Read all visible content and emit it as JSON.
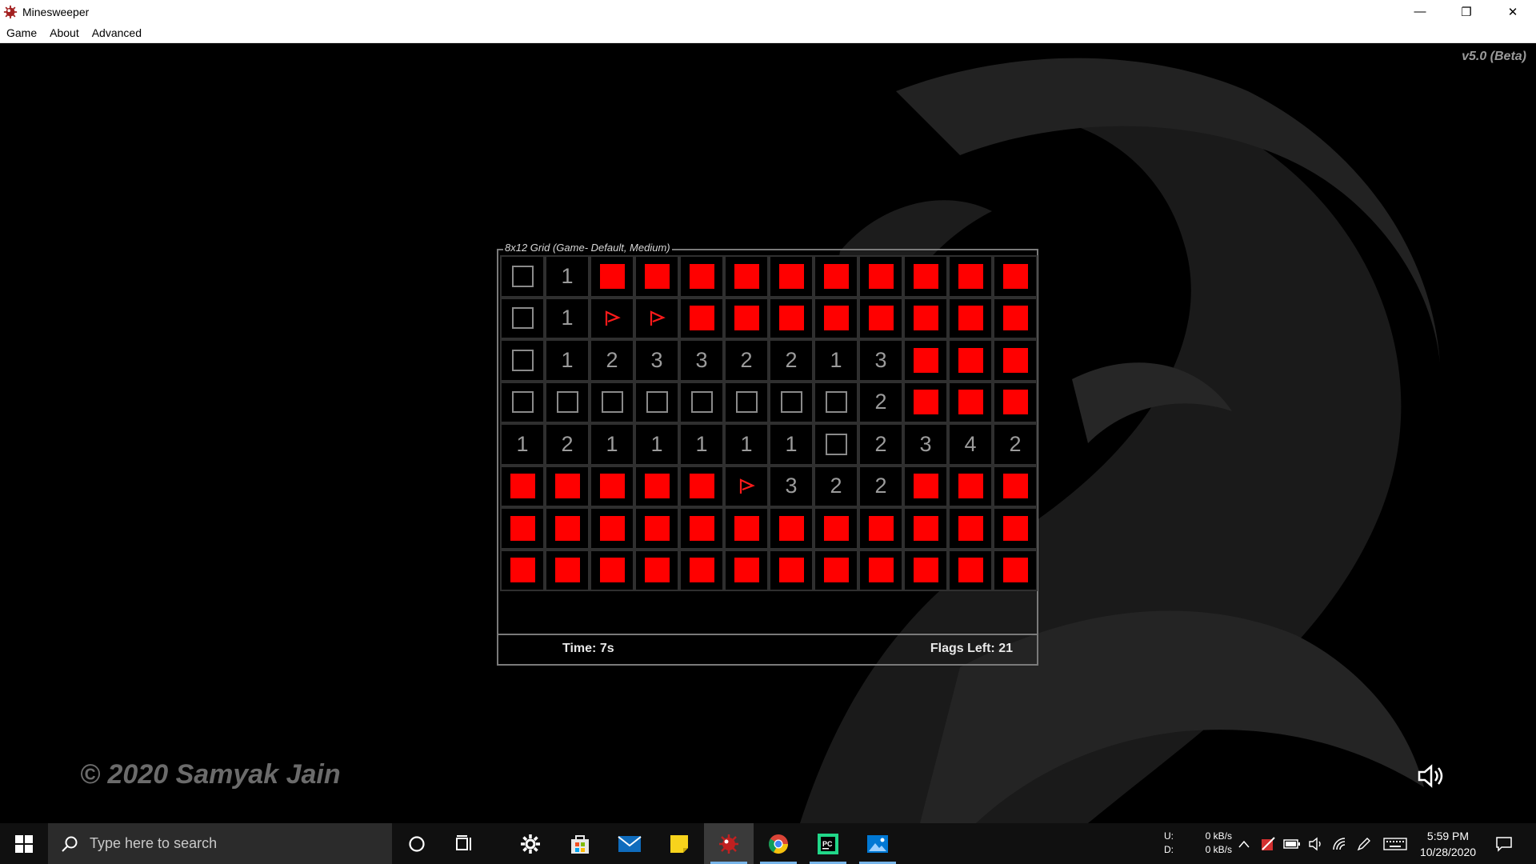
{
  "window": {
    "title": "Minesweeper",
    "controls": {
      "minimize": "—",
      "restore": "❐",
      "close": "✕"
    }
  },
  "menu": [
    "Game",
    "About",
    "Advanced"
  ],
  "version": "v5.0 (Beta)",
  "copyright": "© 2020 Samyak Jain",
  "panel": {
    "legend": "8x12 Grid (Game- Default, Medium)",
    "time": "Time: 7s",
    "flags": "Flags Left: 21"
  },
  "grid": [
    [
      "E",
      "1",
      "R",
      "R",
      "R",
      "R",
      "R",
      "R",
      "R",
      "R",
      "R",
      "R"
    ],
    [
      "E",
      "1",
      "F",
      "F",
      "R",
      "R",
      "R",
      "R",
      "R",
      "R",
      "R",
      "R"
    ],
    [
      "E",
      "1",
      "2",
      "3",
      "3",
      "2",
      "2",
      "1",
      "3",
      "R",
      "R",
      "R"
    ],
    [
      "E",
      "E",
      "E",
      "E",
      "E",
      "E",
      "E",
      "E",
      "2",
      "R",
      "R",
      "R"
    ],
    [
      "1",
      "2",
      "1",
      "1",
      "1",
      "1",
      "1",
      "E",
      "2",
      "3",
      "4",
      "2"
    ],
    [
      "R",
      "R",
      "R",
      "R",
      "R",
      "F",
      "3",
      "2",
      "2",
      "R",
      "R",
      "R"
    ],
    [
      "R",
      "R",
      "R",
      "R",
      "R",
      "R",
      "R",
      "R",
      "R",
      "R",
      "R",
      "R"
    ],
    [
      "R",
      "R",
      "R",
      "R",
      "R",
      "R",
      "R",
      "R",
      "R",
      "R",
      "R",
      "R"
    ]
  ],
  "colors": {
    "red_tile": "#ff0000",
    "number": "#9b9b9b",
    "background": "#000000"
  },
  "taskbar": {
    "search_placeholder": "Type here to search",
    "net_labels": [
      "U:",
      "D:"
    ],
    "net_values": [
      "0 kB/s",
      "0 kB/s"
    ],
    "time": "5:59 PM",
    "date": "10/28/2020"
  }
}
